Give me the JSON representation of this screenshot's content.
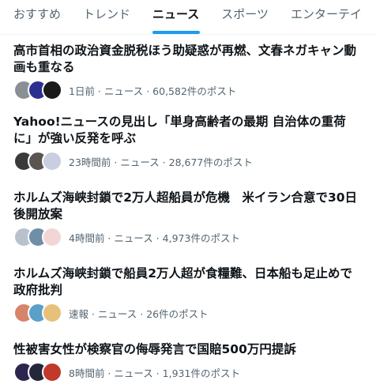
{
  "tabs": [
    {
      "label": "おすすめ",
      "active": false
    },
    {
      "label": "トレンド",
      "active": false
    },
    {
      "label": "ニュース",
      "active": true
    },
    {
      "label": "スポーツ",
      "active": false
    },
    {
      "label": "エンターテイ",
      "active": false
    }
  ],
  "accent_color": "#1d9bf0",
  "news": [
    {
      "title": "高市首相の政治資金脱税ほう助疑惑が再燃、文春ネガキャン動画も重なる",
      "meta": "1日前 · ニュース · 60,582件のポスト",
      "avatars": [
        "#8a8f96",
        "#2b2f8f",
        "#1a1a1a"
      ]
    },
    {
      "title": "Yahoo!ニュースの見出し「単身高齢者の最期 自治体の重荷に」が強い反発を呼ぶ",
      "meta": "23時間前 · ニュース · 28,677件のポスト",
      "avatars": [
        "#3a3a3a",
        "#5a5550",
        "#c9cfe0"
      ]
    },
    {
      "title": "ホルムズ海峡封鎖で2万人超船員が危機　米イラン合意で30日後開放案",
      "meta": "4時間前 · ニュース · 4,973件のポスト",
      "avatars": [
        "#b9c2cc",
        "#6f8ea8",
        "#f2d6d6"
      ]
    },
    {
      "title": "ホルムズ海峡封鎖で船員2万人超が食糧難、日本船も足止めで政府批判",
      "meta": "速報 · ニュース · 26件のポスト",
      "avatars": [
        "#d8846a",
        "#5aa0c8",
        "#e7c07a"
      ]
    },
    {
      "title": "性被害女性が検察官の侮辱発言で国賠500万円提訴",
      "meta": "8時間前 · ニュース · 1,931件のポスト",
      "avatars": [
        "#2e2450",
        "#24263a",
        "#c0392b"
      ]
    }
  ]
}
